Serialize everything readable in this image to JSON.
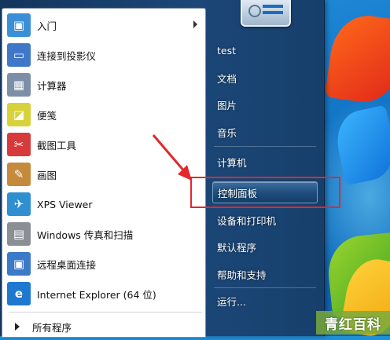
{
  "programs": [
    {
      "label": "入门",
      "icon": "getting-started-icon",
      "color": "#3a8fd6",
      "has_arrow": true
    },
    {
      "label": "连接到投影仪",
      "icon": "projector-icon",
      "color": "#3f78c8",
      "has_arrow": false
    },
    {
      "label": "计算器",
      "icon": "calculator-icon",
      "color": "#7c8fa6",
      "has_arrow": false
    },
    {
      "label": "便笺",
      "icon": "sticky-notes-icon",
      "color": "#d7d23a",
      "has_arrow": false
    },
    {
      "label": "截图工具",
      "icon": "snipping-tool-icon",
      "color": "#d63a3a",
      "has_arrow": false
    },
    {
      "label": "画图",
      "icon": "paint-icon",
      "color": "#c58a3b",
      "has_arrow": false
    },
    {
      "label": "XPS Viewer",
      "icon": "xps-viewer-icon",
      "color": "#2f8fd0",
      "has_arrow": false
    },
    {
      "label": "Windows 传真和扫描",
      "icon": "fax-scan-icon",
      "color": "#8a8f96",
      "has_arrow": false
    },
    {
      "label": "远程桌面连接",
      "icon": "remote-desktop-icon",
      "color": "#3b79c9",
      "has_arrow": false
    },
    {
      "label": "Internet Explorer (64 位)",
      "icon": "internet-explorer-icon",
      "color": "#1e78d0",
      "has_arrow": false
    }
  ],
  "all_programs_label": "所有程序",
  "right_items": [
    {
      "label": "test"
    },
    {
      "label": "文档"
    },
    {
      "label": "图片"
    },
    {
      "label": "音乐"
    },
    {
      "label": "计算机"
    },
    {
      "label": "控制面板"
    },
    {
      "label": "设备和打印机"
    },
    {
      "label": "默认程序"
    },
    {
      "label": "帮助和支持"
    },
    {
      "label": "运行..."
    }
  ],
  "highlighted_item": "控制面板",
  "watermark": "青红百科",
  "colors": {
    "annotation": "#e3272d",
    "menu_bg": "#1b4778",
    "highlight": "#2b5d8f"
  }
}
